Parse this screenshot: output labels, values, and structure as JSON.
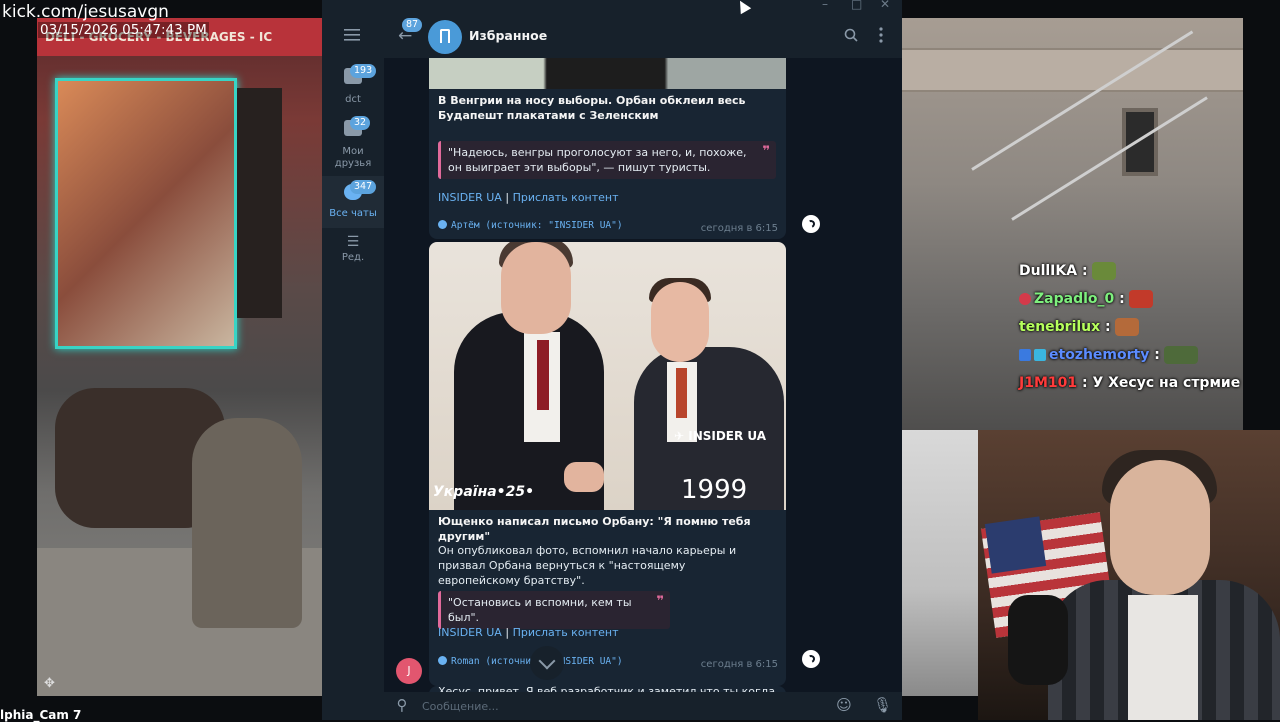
{
  "overlay": {
    "stream_url": "kick.com/jesusavgn",
    "camera_timestamp": "03/15/2026 05:47:43 PM",
    "camera_label": "lphia_Cam 7",
    "store_sign": "DELI - GROCERY - BEVERAGES - IC"
  },
  "telegram": {
    "folders": [
      {
        "label": "dct",
        "badge": "193"
      },
      {
        "label": "Мои друзья",
        "badge": "32"
      },
      {
        "label": "Все чаты",
        "badge": "347"
      },
      {
        "label": "Ред.",
        "badge": ""
      }
    ],
    "header": {
      "back_badge": "87",
      "chat_title": "Избранное"
    },
    "messages": [
      {
        "title": "В Венгрии на носу выборы. Орбан обклеил весь Будапешт плакатами с Зеленским",
        "quote": "\"Надеюсь, венгры проголосуют за него, и, похоже, он выиграет эти выборы\", — пишут туристы.",
        "link1": "INSIDER UA",
        "separator": "|",
        "link2": "Прислать контент",
        "signature": "Артём (источник: \"INSIDER UA\")",
        "time": "сегодня в 6:15"
      },
      {
        "photo_watermark": "INSIDER UA",
        "photo_year": "1999",
        "photo_caption": "Україна•25•",
        "title": "Ющенко написал письмо Орбану: \"Я помню тебя другим\"",
        "text": "Он опубликовал фото, вспомнил начало карьеры и призвал Орбана вернуться к \"настоящему европейскому братству\".",
        "quote": "\"Остановись и вспомни, кем ты был\".",
        "link1": "INSIDER UA",
        "separator": "|",
        "link2": "Прислать контент",
        "signature": "Roman (источник: \"INSIDER UA\")",
        "time": "сегодня в 6:15"
      }
    ],
    "partial_message": "Хесус, привет. Я веб разработчик и заметил что ты когда",
    "user_avatar_letter": "J",
    "input_placeholder": "Сообщение..."
  },
  "stream_chat": [
    {
      "user": "DullIKA",
      "text": "",
      "color": "#ffffff"
    },
    {
      "user": "Zapadlo_0",
      "text": "",
      "color": "#7ef07e"
    },
    {
      "user": "tenebrilux",
      "text": "",
      "color": "#b6ff5c"
    },
    {
      "user": "etozhemorty",
      "text": "",
      "color": "#5c8cff"
    },
    {
      "user": "J1M101",
      "text": "У Хесус на стрмие",
      "color": "#ff3b3b"
    }
  ]
}
